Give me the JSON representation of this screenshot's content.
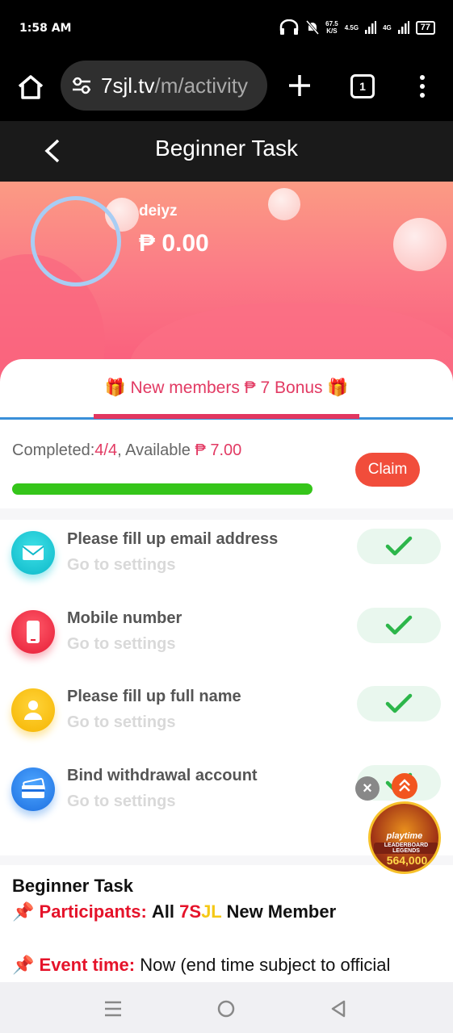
{
  "status_bar": {
    "time": "1:58 AM",
    "net_speed_value": "67.5",
    "net_speed_unit": "K/S",
    "signal_1": "4.5G",
    "signal_2": "4G",
    "battery": "77"
  },
  "browser": {
    "url_main": "7sjl.tv",
    "url_path": "/m/activity",
    "tab_count": "1"
  },
  "header": {
    "title": "Beginner Task"
  },
  "profile": {
    "username": "deiyz",
    "balance": "₱ 0.00"
  },
  "bonus_tab": {
    "label": "🎁 New members ₱ 7 Bonus 🎁"
  },
  "progress": {
    "completed_label": "Completed:",
    "completed_value": "4/4",
    "available_label": ", Available ",
    "available_value": "₱ 7.00",
    "fraction": 1.0,
    "claim_label": "Claim"
  },
  "tasks": [
    {
      "title": "Please fill up email address",
      "subtitle": "Go to settings",
      "icon": "email-icon",
      "done": true
    },
    {
      "title": "Mobile number",
      "subtitle": "Go to settings",
      "icon": "mobile-icon",
      "done": true
    },
    {
      "title": "Please fill up full name",
      "subtitle": "Go to settings",
      "icon": "user-icon",
      "done": true
    },
    {
      "title": "Bind withdrawal account",
      "subtitle": "Go to settings",
      "icon": "card-icon",
      "done": true
    }
  ],
  "description": {
    "title": "Beginner Task",
    "participants_label": "Participants:",
    "participants_pre": "All ",
    "brand_7s": "7S",
    "brand_jl": "JL",
    "participants_post": " New Member",
    "event_label": "Event time:",
    "event_value": "Now (end time subject to official"
  },
  "promo": {
    "brand": "playtime",
    "subtitle": "LEADERBOARD LEGENDS",
    "amount": "564,000"
  },
  "colors": {
    "accent_red": "#e23a63",
    "claim_button": "#f14d3b",
    "progress_green": "#35c51a",
    "tab_blue": "#3a8fd9",
    "check_green": "#2cb64a"
  }
}
